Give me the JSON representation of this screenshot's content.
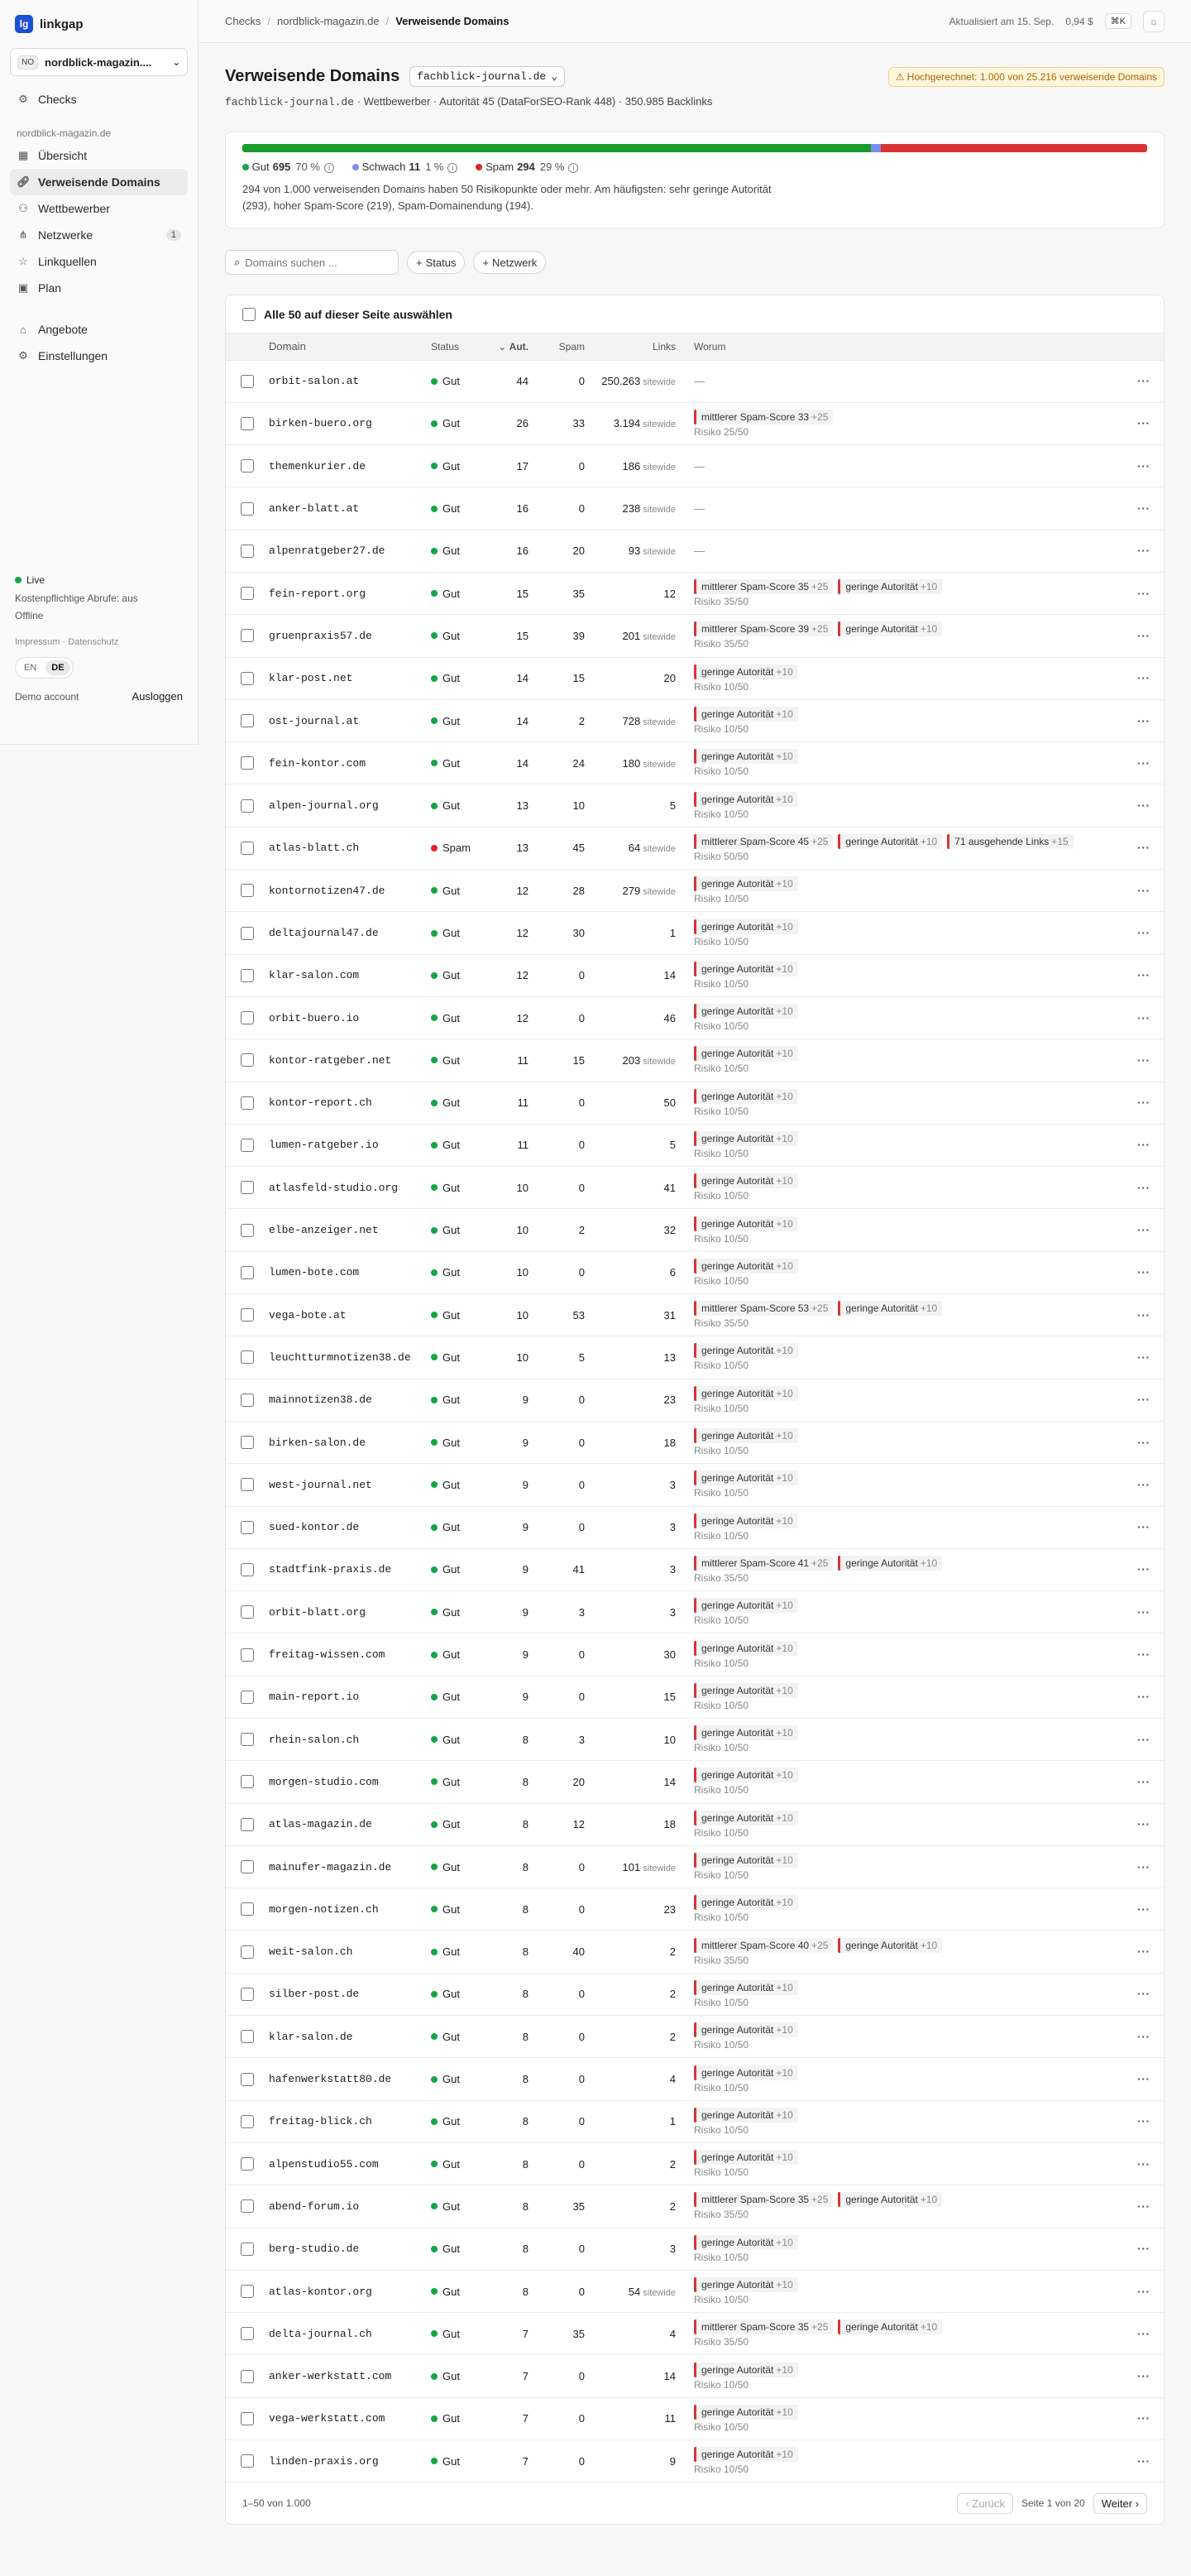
{
  "brand": {
    "name": "linkgap",
    "logo": "lg"
  },
  "project": {
    "badge": "NO",
    "name": "nordblick-magazin...."
  },
  "sidebar": {
    "items": [
      {
        "label": "Checks",
        "icon": "gear-icon"
      },
      {
        "label": "Übersicht",
        "icon": "grid-icon"
      },
      {
        "label": "Verweisende Domains",
        "icon": "link-icon",
        "active": true
      },
      {
        "label": "Wettbewerber",
        "icon": "users-icon"
      },
      {
        "label": "Netzwerke",
        "icon": "network-icon",
        "count": "1"
      },
      {
        "label": "Linkquellen",
        "icon": "star-icon"
      },
      {
        "label": "Plan",
        "icon": "calendar-icon"
      },
      {
        "label": "Angebote",
        "icon": "tag-icon"
      },
      {
        "label": "Einstellungen",
        "icon": "gear-icon"
      }
    ],
    "section": "nordblick-magazin.de",
    "live": "Live",
    "paid_calls": "Kostenpflichtige Abrufe: aus",
    "offline": "Offline",
    "impressum": "Impressum",
    "datenschutz": "Datenschutz",
    "lang_en": "EN",
    "lang_de": "DE",
    "demo": "Demo account",
    "logout": "Ausloggen"
  },
  "topbar": {
    "crumbs": [
      "Checks",
      "nordblick-magazin.de",
      "Verweisende Domains"
    ],
    "updated": "Aktualisiert am 15. Sep.",
    "cost": "0,94 $",
    "kbd": "⌘K"
  },
  "page": {
    "title": "Verweisende Domains",
    "site": "fachblick-journal.de",
    "warning": "⚠ Hochgerechnet: 1.000 von 25.216 verweisende Domains",
    "sub_domain": "fachblick-journal.de",
    "sub_rest": " · Wettbewerber · Autorität 45 (DataForSEO-Rank 448) · 350.985 Backlinks"
  },
  "summary": {
    "good": {
      "label": "Gut",
      "count": "695",
      "pct": "70 %",
      "value": 695
    },
    "weak": {
      "label": "Schwach",
      "count": "11",
      "pct": "1 %",
      "value": 11
    },
    "spam": {
      "label": "Spam",
      "count": "294",
      "pct": "29 %",
      "value": 294
    },
    "text": "294 von 1.000 verweisenden Domains haben 50 Risikopunkte oder mehr. Am häufigsten: sehr geringe Autorität (293), hoher Spam-Score (219), Spam-Domainendung (194)."
  },
  "filters": {
    "search_placeholder": "Domains suchen ...",
    "status": "Status",
    "network": "Netzwerk"
  },
  "table": {
    "select_all": "Alle 50 auf dieser Seite auswählen",
    "headers": {
      "domain": "Domain",
      "status": "Status",
      "aut": "Aut.",
      "spam": "Spam",
      "links": "Links",
      "why": "Worum"
    },
    "sitewide": "sitewide",
    "rows": [
      {
        "domain": "orbit-salon.at",
        "status": "Gut",
        "aut": "44",
        "spam": "0",
        "links": "250.263",
        "sw": true,
        "reasons": [],
        "risk": ""
      },
      {
        "domain": "birken-buero.org",
        "status": "Gut",
        "aut": "26",
        "spam": "33",
        "links": "3.194",
        "sw": true,
        "reasons": [
          {
            "t": "mittlerer Spam-Score 33",
            "p": "+25"
          }
        ],
        "risk": "Risiko 25/50"
      },
      {
        "domain": "themenkurier.de",
        "status": "Gut",
        "aut": "17",
        "spam": "0",
        "links": "186",
        "sw": true,
        "reasons": [],
        "risk": ""
      },
      {
        "domain": "anker-blatt.at",
        "status": "Gut",
        "aut": "16",
        "spam": "0",
        "links": "238",
        "sw": true,
        "reasons": [],
        "risk": ""
      },
      {
        "domain": "alpenratgeber27.de",
        "status": "Gut",
        "aut": "16",
        "spam": "20",
        "links": "93",
        "sw": true,
        "reasons": [],
        "risk": ""
      },
      {
        "domain": "fein-report.org",
        "status": "Gut",
        "aut": "15",
        "spam": "35",
        "links": "12",
        "sw": false,
        "reasons": [
          {
            "t": "mittlerer Spam-Score 35",
            "p": "+25"
          },
          {
            "t": "geringe Autorität",
            "p": "+10"
          }
        ],
        "risk": "Risiko 35/50"
      },
      {
        "domain": "gruenpraxis57.de",
        "status": "Gut",
        "aut": "15",
        "spam": "39",
        "links": "201",
        "sw": true,
        "reasons": [
          {
            "t": "mittlerer Spam-Score 39",
            "p": "+25"
          },
          {
            "t": "geringe Autorität",
            "p": "+10"
          }
        ],
        "risk": "Risiko 35/50"
      },
      {
        "domain": "klar-post.net",
        "status": "Gut",
        "aut": "14",
        "spam": "15",
        "links": "20",
        "sw": false,
        "reasons": [
          {
            "t": "geringe Autorität",
            "p": "+10"
          }
        ],
        "risk": "Risiko 10/50"
      },
      {
        "domain": "ost-journal.at",
        "status": "Gut",
        "aut": "14",
        "spam": "2",
        "links": "728",
        "sw": true,
        "reasons": [
          {
            "t": "geringe Autorität",
            "p": "+10"
          }
        ],
        "risk": "Risiko 10/50"
      },
      {
        "domain": "fein-kontor.com",
        "status": "Gut",
        "aut": "14",
        "spam": "24",
        "links": "180",
        "sw": true,
        "reasons": [
          {
            "t": "geringe Autorität",
            "p": "+10"
          }
        ],
        "risk": "Risiko 10/50"
      },
      {
        "domain": "alpen-journal.org",
        "status": "Gut",
        "aut": "13",
        "spam": "10",
        "links": "5",
        "sw": false,
        "reasons": [
          {
            "t": "geringe Autorität",
            "p": "+10"
          }
        ],
        "risk": "Risiko 10/50"
      },
      {
        "domain": "atlas-blatt.ch",
        "status": "Spam",
        "aut": "13",
        "spam": "45",
        "links": "64",
        "sw": true,
        "reasons": [
          {
            "t": "mittlerer Spam-Score 45",
            "p": "+25"
          },
          {
            "t": "geringe Autorität",
            "p": "+10"
          },
          {
            "t": "71 ausgehende Links",
            "p": "+15"
          }
        ],
        "risk": "Risiko 50/50"
      },
      {
        "domain": "kontornotizen47.de",
        "status": "Gut",
        "aut": "12",
        "spam": "28",
        "links": "279",
        "sw": true,
        "reasons": [
          {
            "t": "geringe Autorität",
            "p": "+10"
          }
        ],
        "risk": "Risiko 10/50"
      },
      {
        "domain": "deltajournal47.de",
        "status": "Gut",
        "aut": "12",
        "spam": "30",
        "links": "1",
        "sw": false,
        "reasons": [
          {
            "t": "geringe Autorität",
            "p": "+10"
          }
        ],
        "risk": "Risiko 10/50"
      },
      {
        "domain": "klar-salon.com",
        "status": "Gut",
        "aut": "12",
        "spam": "0",
        "links": "14",
        "sw": false,
        "reasons": [
          {
            "t": "geringe Autorität",
            "p": "+10"
          }
        ],
        "risk": "Risiko 10/50"
      },
      {
        "domain": "orbit-buero.io",
        "status": "Gut",
        "aut": "12",
        "spam": "0",
        "links": "46",
        "sw": false,
        "reasons": [
          {
            "t": "geringe Autorität",
            "p": "+10"
          }
        ],
        "risk": "Risiko 10/50"
      },
      {
        "domain": "kontor-ratgeber.net",
        "status": "Gut",
        "aut": "11",
        "spam": "15",
        "links": "203",
        "sw": true,
        "reasons": [
          {
            "t": "geringe Autorität",
            "p": "+10"
          }
        ],
        "risk": "Risiko 10/50"
      },
      {
        "domain": "kontor-report.ch",
        "status": "Gut",
        "aut": "11",
        "spam": "0",
        "links": "50",
        "sw": false,
        "reasons": [
          {
            "t": "geringe Autorität",
            "p": "+10"
          }
        ],
        "risk": "Risiko 10/50"
      },
      {
        "domain": "lumen-ratgeber.io",
        "status": "Gut",
        "aut": "11",
        "spam": "0",
        "links": "5",
        "sw": false,
        "reasons": [
          {
            "t": "geringe Autorität",
            "p": "+10"
          }
        ],
        "risk": "Risiko 10/50"
      },
      {
        "domain": "atlasfeld-studio.org",
        "status": "Gut",
        "aut": "10",
        "spam": "0",
        "links": "41",
        "sw": false,
        "reasons": [
          {
            "t": "geringe Autorität",
            "p": "+10"
          }
        ],
        "risk": "Risiko 10/50"
      },
      {
        "domain": "elbe-anzeiger.net",
        "status": "Gut",
        "aut": "10",
        "spam": "2",
        "links": "32",
        "sw": false,
        "reasons": [
          {
            "t": "geringe Autorität",
            "p": "+10"
          }
        ],
        "risk": "Risiko 10/50"
      },
      {
        "domain": "lumen-bote.com",
        "status": "Gut",
        "aut": "10",
        "spam": "0",
        "links": "6",
        "sw": false,
        "reasons": [
          {
            "t": "geringe Autorität",
            "p": "+10"
          }
        ],
        "risk": "Risiko 10/50"
      },
      {
        "domain": "vega-bote.at",
        "status": "Gut",
        "aut": "10",
        "spam": "53",
        "links": "31",
        "sw": false,
        "reasons": [
          {
            "t": "mittlerer Spam-Score 53",
            "p": "+25"
          },
          {
            "t": "geringe Autorität",
            "p": "+10"
          }
        ],
        "risk": "Risiko 35/50"
      },
      {
        "domain": "leuchtturmnotizen38.de",
        "status": "Gut",
        "aut": "10",
        "spam": "5",
        "links": "13",
        "sw": false,
        "reasons": [
          {
            "t": "geringe Autorität",
            "p": "+10"
          }
        ],
        "risk": "Risiko 10/50"
      },
      {
        "domain": "mainnotizen38.de",
        "status": "Gut",
        "aut": "9",
        "spam": "0",
        "links": "23",
        "sw": false,
        "reasons": [
          {
            "t": "geringe Autorität",
            "p": "+10"
          }
        ],
        "risk": "Risiko 10/50"
      },
      {
        "domain": "birken-salon.de",
        "status": "Gut",
        "aut": "9",
        "spam": "0",
        "links": "18",
        "sw": false,
        "reasons": [
          {
            "t": "geringe Autorität",
            "p": "+10"
          }
        ],
        "risk": "Risiko 10/50"
      },
      {
        "domain": "west-journal.net",
        "status": "Gut",
        "aut": "9",
        "spam": "0",
        "links": "3",
        "sw": false,
        "reasons": [
          {
            "t": "geringe Autorität",
            "p": "+10"
          }
        ],
        "risk": "Risiko 10/50"
      },
      {
        "domain": "sued-kontor.de",
        "status": "Gut",
        "aut": "9",
        "spam": "0",
        "links": "3",
        "sw": false,
        "reasons": [
          {
            "t": "geringe Autorität",
            "p": "+10"
          }
        ],
        "risk": "Risiko 10/50"
      },
      {
        "domain": "stadtfink-praxis.de",
        "status": "Gut",
        "aut": "9",
        "spam": "41",
        "links": "3",
        "sw": false,
        "reasons": [
          {
            "t": "mittlerer Spam-Score 41",
            "p": "+25"
          },
          {
            "t": "geringe Autorität",
            "p": "+10"
          }
        ],
        "risk": "Risiko 35/50"
      },
      {
        "domain": "orbit-blatt.org",
        "status": "Gut",
        "aut": "9",
        "spam": "3",
        "links": "3",
        "sw": false,
        "reasons": [
          {
            "t": "geringe Autorität",
            "p": "+10"
          }
        ],
        "risk": "Risiko 10/50"
      },
      {
        "domain": "freitag-wissen.com",
        "status": "Gut",
        "aut": "9",
        "spam": "0",
        "links": "30",
        "sw": false,
        "reasons": [
          {
            "t": "geringe Autorität",
            "p": "+10"
          }
        ],
        "risk": "Risiko 10/50"
      },
      {
        "domain": "main-report.io",
        "status": "Gut",
        "aut": "9",
        "spam": "0",
        "links": "15",
        "sw": false,
        "reasons": [
          {
            "t": "geringe Autorität",
            "p": "+10"
          }
        ],
        "risk": "Risiko 10/50"
      },
      {
        "domain": "rhein-salon.ch",
        "status": "Gut",
        "aut": "8",
        "spam": "3",
        "links": "10",
        "sw": false,
        "reasons": [
          {
            "t": "geringe Autorität",
            "p": "+10"
          }
        ],
        "risk": "Risiko 10/50"
      },
      {
        "domain": "morgen-studio.com",
        "status": "Gut",
        "aut": "8",
        "spam": "20",
        "links": "14",
        "sw": false,
        "reasons": [
          {
            "t": "geringe Autorität",
            "p": "+10"
          }
        ],
        "risk": "Risiko 10/50"
      },
      {
        "domain": "atlas-magazin.de",
        "status": "Gut",
        "aut": "8",
        "spam": "12",
        "links": "18",
        "sw": false,
        "reasons": [
          {
            "t": "geringe Autorität",
            "p": "+10"
          }
        ],
        "risk": "Risiko 10/50"
      },
      {
        "domain": "mainufer-magazin.de",
        "status": "Gut",
        "aut": "8",
        "spam": "0",
        "links": "101",
        "sw": true,
        "reasons": [
          {
            "t": "geringe Autorität",
            "p": "+10"
          }
        ],
        "risk": "Risiko 10/50"
      },
      {
        "domain": "morgen-notizen.ch",
        "status": "Gut",
        "aut": "8",
        "spam": "0",
        "links": "23",
        "sw": false,
        "reasons": [
          {
            "t": "geringe Autorität",
            "p": "+10"
          }
        ],
        "risk": "Risiko 10/50"
      },
      {
        "domain": "weit-salon.ch",
        "status": "Gut",
        "aut": "8",
        "spam": "40",
        "links": "2",
        "sw": false,
        "reasons": [
          {
            "t": "mittlerer Spam-Score 40",
            "p": "+25"
          },
          {
            "t": "geringe Autorität",
            "p": "+10"
          }
        ],
        "risk": "Risiko 35/50"
      },
      {
        "domain": "silber-post.de",
        "status": "Gut",
        "aut": "8",
        "spam": "0",
        "links": "2",
        "sw": false,
        "reasons": [
          {
            "t": "geringe Autorität",
            "p": "+10"
          }
        ],
        "risk": "Risiko 10/50"
      },
      {
        "domain": "klar-salon.de",
        "status": "Gut",
        "aut": "8",
        "spam": "0",
        "links": "2",
        "sw": false,
        "reasons": [
          {
            "t": "geringe Autorität",
            "p": "+10"
          }
        ],
        "risk": "Risiko 10/50"
      },
      {
        "domain": "hafenwerkstatt80.de",
        "status": "Gut",
        "aut": "8",
        "spam": "0",
        "links": "4",
        "sw": false,
        "reasons": [
          {
            "t": "geringe Autorität",
            "p": "+10"
          }
        ],
        "risk": "Risiko 10/50"
      },
      {
        "domain": "freitag-blick.ch",
        "status": "Gut",
        "aut": "8",
        "spam": "0",
        "links": "1",
        "sw": false,
        "reasons": [
          {
            "t": "geringe Autorität",
            "p": "+10"
          }
        ],
        "risk": "Risiko 10/50"
      },
      {
        "domain": "alpenstudio55.com",
        "status": "Gut",
        "aut": "8",
        "spam": "0",
        "links": "2",
        "sw": false,
        "reasons": [
          {
            "t": "geringe Autorität",
            "p": "+10"
          }
        ],
        "risk": "Risiko 10/50"
      },
      {
        "domain": "abend-forum.io",
        "status": "Gut",
        "aut": "8",
        "spam": "35",
        "links": "2",
        "sw": false,
        "reasons": [
          {
            "t": "mittlerer Spam-Score 35",
            "p": "+25"
          },
          {
            "t": "geringe Autorität",
            "p": "+10"
          }
        ],
        "risk": "Risiko 35/50"
      },
      {
        "domain": "berg-studio.de",
        "status": "Gut",
        "aut": "8",
        "spam": "0",
        "links": "3",
        "sw": false,
        "reasons": [
          {
            "t": "geringe Autorität",
            "p": "+10"
          }
        ],
        "risk": "Risiko 10/50"
      },
      {
        "domain": "atlas-kontor.org",
        "status": "Gut",
        "aut": "8",
        "spam": "0",
        "links": "54",
        "sw": true,
        "reasons": [
          {
            "t": "geringe Autorität",
            "p": "+10"
          }
        ],
        "risk": "Risiko 10/50"
      },
      {
        "domain": "delta-journal.ch",
        "status": "Gut",
        "aut": "7",
        "spam": "35",
        "links": "4",
        "sw": false,
        "reasons": [
          {
            "t": "mittlerer Spam-Score 35",
            "p": "+25"
          },
          {
            "t": "geringe Autorität",
            "p": "+10"
          }
        ],
        "risk": "Risiko 35/50"
      },
      {
        "domain": "anker-werkstatt.com",
        "status": "Gut",
        "aut": "7",
        "spam": "0",
        "links": "14",
        "sw": false,
        "reasons": [
          {
            "t": "geringe Autorität",
            "p": "+10"
          }
        ],
        "risk": "Risiko 10/50"
      },
      {
        "domain": "vega-werkstatt.com",
        "status": "Gut",
        "aut": "7",
        "spam": "0",
        "links": "11",
        "sw": false,
        "reasons": [
          {
            "t": "geringe Autorität",
            "p": "+10"
          }
        ],
        "risk": "Risiko 10/50"
      },
      {
        "domain": "linden-praxis.org",
        "status": "Gut",
        "aut": "7",
        "spam": "0",
        "links": "9",
        "sw": false,
        "reasons": [
          {
            "t": "geringe Autorität",
            "p": "+10"
          }
        ],
        "risk": "Risiko 10/50"
      }
    ]
  },
  "pagination": {
    "range": "1–50 von 1.000",
    "prev": "‹ Zurück",
    "page": "Seite 1 von 20",
    "next": "Weiter ›"
  },
  "colors": {
    "good": "#16a34a",
    "weak": "#7c8df0",
    "spam": "#dc2626",
    "accent": "#1d4ed8"
  }
}
